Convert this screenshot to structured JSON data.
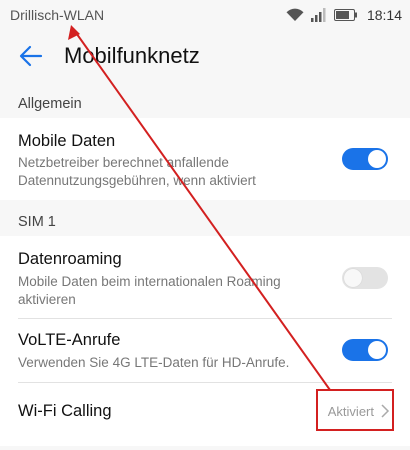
{
  "status_bar": {
    "carrier": "Drillisch-WLAN",
    "time": "18:14",
    "icons": [
      "wifi-icon",
      "signal-icon",
      "battery-icon"
    ]
  },
  "header": {
    "title": "Mobilfunknetz",
    "back_icon": "arrow-back-icon"
  },
  "sections": {
    "general": "Allgemein",
    "sim1": "SIM 1"
  },
  "rows": {
    "mobile_data": {
      "title": "Mobile Daten",
      "desc_line1": "Netzbetreiber berechnet anfallende",
      "desc_line2": "Datennutzungsgebühren, wenn aktiviert",
      "enabled": true
    },
    "roaming": {
      "title": "Datenroaming",
      "desc_line1": "Mobile Daten beim internationalen Roaming",
      "desc_line2": "aktivieren",
      "enabled": false
    },
    "volte": {
      "title": "VoLTE-Anrufe",
      "desc_line1": "Verwenden Sie 4G LTE-Daten für HD-Anrufe.",
      "enabled": true
    },
    "wifi_calling": {
      "title": "Wi-Fi Calling",
      "value": "Aktiviert"
    }
  },
  "colors": {
    "accent": "#1a73e8",
    "annotation": "#d32020"
  }
}
